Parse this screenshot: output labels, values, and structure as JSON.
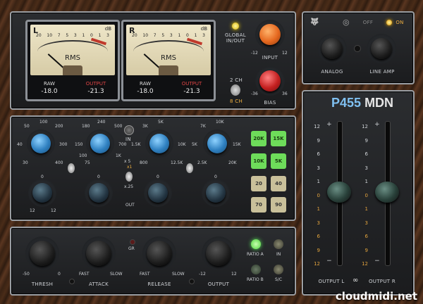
{
  "meters": {
    "left": {
      "channel": "L",
      "db_unit": "dB",
      "scale": [
        "20",
        "10",
        "7",
        "5",
        "3",
        "1",
        "0",
        "1",
        "3"
      ],
      "mode": "RMS",
      "raw_label": "RAW",
      "raw_value": "-18.0",
      "output_label": "OUTPUT",
      "output_value": "-21.3"
    },
    "right": {
      "channel": "R",
      "db_unit": "dB",
      "scale": [
        "20",
        "10",
        "7",
        "5",
        "3",
        "1",
        "0",
        "1",
        "3"
      ],
      "mode": "RMS",
      "raw_label": "RAW",
      "raw_value": "-18.0",
      "output_label": "OUTPUT",
      "output_value": "-21.3"
    }
  },
  "io": {
    "global_label_1": "GLOBAL",
    "global_label_2": "IN/OUT",
    "input_label": "INPUT",
    "input_min": "-12",
    "input_max": "12",
    "bias_label": "BIAS",
    "bias_min": "-36",
    "bias_max": "36",
    "ch2_label": "2 CH",
    "ch8_label": "8 CH"
  },
  "top_right": {
    "off_label": "OFF",
    "on_label": "ON",
    "analog_label": "ANALOG",
    "line_amp_label": "LINE AMP"
  },
  "eq": {
    "band1": {
      "ticks": [
        "50",
        "100",
        "200",
        "40",
        "300",
        "30",
        "400"
      ]
    },
    "band2": {
      "ticks": [
        "180",
        "240",
        "500",
        "150",
        "700",
        "100",
        "1K",
        "75"
      ]
    },
    "band3": {
      "ticks": [
        "3K",
        "5K",
        "1.5K",
        "10K",
        "800",
        "12.5K"
      ]
    },
    "band4": {
      "ticks": [
        "7K",
        "10K",
        "5K",
        "15K",
        "2.5K",
        "20K"
      ]
    },
    "in_label": "IN",
    "x5": "x 5",
    "x1": "x1",
    "x25": "x.25",
    "out_label": "OUT",
    "gain_ticks": [
      "0",
      "2",
      "4",
      "6",
      "8",
      "9",
      "12"
    ],
    "shelf_buttons": [
      "20K",
      "15K",
      "10K",
      "5K",
      "20",
      "40",
      "70",
      "90"
    ]
  },
  "comp": {
    "thresh_label": "THRESH",
    "thresh_min": "-50",
    "thresh_max": "0",
    "attack_label": "ATTACK",
    "attack_fast": "FAST",
    "attack_slow": "SLOW",
    "gr_label": "GR",
    "release_label": "RELEASE",
    "release_fast": "FAST",
    "release_slow": "SLOW",
    "output_label": "OUTPUT",
    "output_min": "-12",
    "output_max": "12",
    "ratio_a": "RATIO A",
    "ratio_b": "RATIO B",
    "in_label": "IN",
    "sc_label": "S/C"
  },
  "output": {
    "title_a": "P",
    "title_num": "455",
    "title_b": " MDN",
    "scale": [
      "12",
      "9",
      "6",
      "3",
      "1",
      "0",
      "1",
      "3",
      "6",
      "9",
      "12"
    ],
    "plus": "+",
    "minus": "−",
    "out_l": "OUTPUT L",
    "out_r": "OUTPUT R"
  },
  "watermark": "cloudmidi.net",
  "colors": {
    "accent_blue": "#2f80c0",
    "accent_orange": "#e5681f",
    "accent_red": "#c42020",
    "led_green": "#57e35a",
    "title_blue": "#7fc0f0",
    "amber": "#e2a33d"
  }
}
